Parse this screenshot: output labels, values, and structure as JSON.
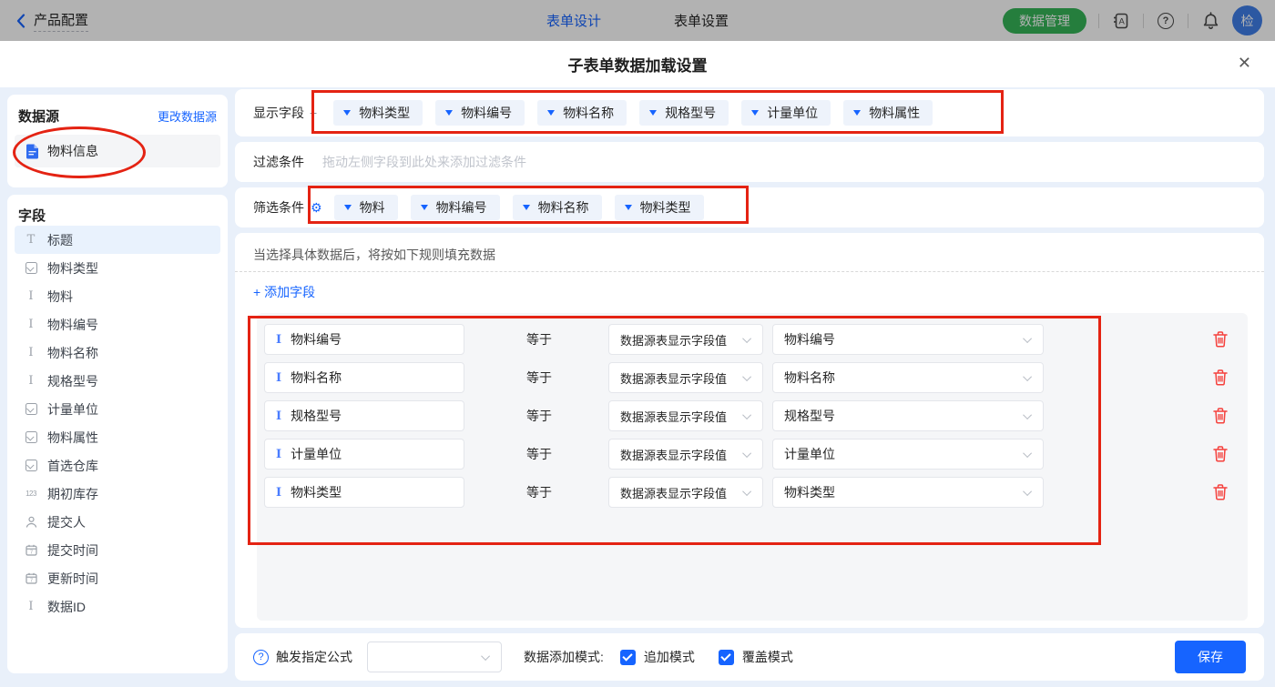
{
  "topbar": {
    "back_label": "产品配置",
    "tabs": [
      {
        "label": "表单设计",
        "active": true
      },
      {
        "label": "表单设置",
        "active": false
      }
    ],
    "data_manage_button": "数据管理",
    "icons": [
      "back-chevron-icon",
      "address-book-icon",
      "help-icon",
      "bell-icon"
    ],
    "avatar_text": "检"
  },
  "modal": {
    "title": "子表单数据加载设置",
    "close_icon": "✕",
    "datasource": {
      "heading": "数据源",
      "change_link": "更改数据源",
      "item_label": "物料信息",
      "item_icon": "document-icon"
    },
    "fields_panel": {
      "heading": "字段",
      "items": [
        {
          "label": "标题",
          "icon": "title-icon",
          "active": true
        },
        {
          "label": "物料类型",
          "icon": "select-icon",
          "active": false
        },
        {
          "label": "物料",
          "icon": "text-icon",
          "active": false
        },
        {
          "label": "物料编号",
          "icon": "text-icon",
          "active": false
        },
        {
          "label": "物料名称",
          "icon": "text-icon",
          "active": false
        },
        {
          "label": "规格型号",
          "icon": "text-icon",
          "active": false
        },
        {
          "label": "计量单位",
          "icon": "select-icon",
          "active": false
        },
        {
          "label": "物料属性",
          "icon": "select-icon",
          "active": false
        },
        {
          "label": "首选仓库",
          "icon": "select-icon",
          "active": false
        },
        {
          "label": "期初库存",
          "icon": "number-icon",
          "active": false
        },
        {
          "label": "提交人",
          "icon": "person-icon",
          "active": false
        },
        {
          "label": "提交时间",
          "icon": "calendar-icon",
          "active": false
        },
        {
          "label": "更新时间",
          "icon": "calendar-icon",
          "active": false
        },
        {
          "label": "数据ID",
          "icon": "text-icon",
          "active": false
        }
      ]
    },
    "display_fields": {
      "label": "显示字段",
      "add_label": "+",
      "tags": [
        "物料类型",
        "物料编号",
        "物料名称",
        "规格型号",
        "计量单位",
        "物料属性"
      ]
    },
    "filter": {
      "label": "过滤条件",
      "placeholder": "拖动左侧字段到此处来添加过滤条件"
    },
    "screen": {
      "label": "筛选条件",
      "gear_icon": "gear-icon",
      "tags": [
        "物料",
        "物料编号",
        "物料名称",
        "物料类型"
      ]
    },
    "rules": {
      "hint": "当选择具体数据后，将按如下规则填充数据",
      "add_field": "+ 添加字段",
      "rows": [
        {
          "field": "物料编号",
          "operator": "等于",
          "source": "数据源表显示字段值",
          "target": "物料编号"
        },
        {
          "field": "物料名称",
          "operator": "等于",
          "source": "数据源表显示字段值",
          "target": "物料名称"
        },
        {
          "field": "规格型号",
          "operator": "等于",
          "source": "数据源表显示字段值",
          "target": "规格型号"
        },
        {
          "field": "计量单位",
          "operator": "等于",
          "source": "数据源表显示字段值",
          "target": "计量单位"
        },
        {
          "field": "物料类型",
          "operator": "等于",
          "source": "数据源表显示字段值",
          "target": "物料类型"
        }
      ]
    },
    "footer": {
      "formula_label": "触发指定公式",
      "mode_label": "数据添加模式:",
      "checkboxes": [
        {
          "label": "追加模式",
          "checked": true
        },
        {
          "label": "覆盖模式",
          "checked": true
        }
      ],
      "save_label": "保存"
    }
  },
  "colors": {
    "accent": "#1664ff",
    "green_button": "#35b558",
    "danger": "#f5413d",
    "annotation_red": "#e42313",
    "tag_background": "#eef3fb",
    "modal_background": "#e9f0fa"
  }
}
